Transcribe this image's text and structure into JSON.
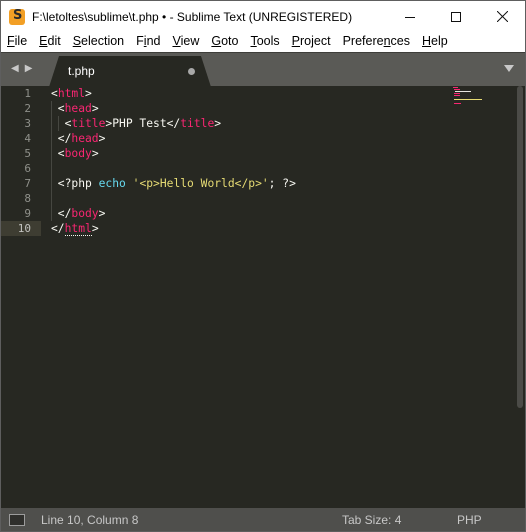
{
  "window": {
    "title": "F:\\letoltes\\sublime\\t.php • - Sublime Text (UNREGISTERED)",
    "app_icon": "sublime-text-icon"
  },
  "menu": [
    {
      "label": "File",
      "mnemonic": "F",
      "rest": "ile"
    },
    {
      "label": "Edit",
      "mnemonic": "E",
      "rest": "dit"
    },
    {
      "label": "Selection",
      "mnemonic": "S",
      "rest": "election"
    },
    {
      "label": "Find",
      "mnemonic": "i",
      "pre": "F",
      "rest": "nd"
    },
    {
      "label": "View",
      "mnemonic": "V",
      "rest": "iew"
    },
    {
      "label": "Goto",
      "mnemonic": "G",
      "rest": "oto"
    },
    {
      "label": "Tools",
      "mnemonic": "T",
      "rest": "ools"
    },
    {
      "label": "Project",
      "mnemonic": "P",
      "rest": "roject"
    },
    {
      "label": "Preferences",
      "mnemonic": "n",
      "pre": "Prefere",
      "rest": "ces"
    },
    {
      "label": "Help",
      "mnemonic": "H",
      "rest": "elp"
    }
  ],
  "tabs": [
    {
      "label": "t.php",
      "modified": true,
      "active": true
    }
  ],
  "editor": {
    "line_numbers": [
      "1",
      "2",
      "3",
      "4",
      "5",
      "6",
      "7",
      "8",
      "9",
      "10"
    ],
    "current_line": 10,
    "lines": [
      [
        {
          "t": "punc",
          "v": "<"
        },
        {
          "t": "tag",
          "v": "html"
        },
        {
          "t": "punc",
          "v": ">"
        }
      ],
      [
        {
          "t": "punc",
          "v": " <"
        },
        {
          "t": "tag",
          "v": "head"
        },
        {
          "t": "punc",
          "v": ">"
        }
      ],
      [
        {
          "t": "punc",
          "v": "  <"
        },
        {
          "t": "tag",
          "v": "title"
        },
        {
          "t": "punc",
          "v": ">PHP Test</"
        },
        {
          "t": "tag",
          "v": "title"
        },
        {
          "t": "punc",
          "v": ">"
        }
      ],
      [
        {
          "t": "punc",
          "v": " </"
        },
        {
          "t": "tag",
          "v": "head"
        },
        {
          "t": "punc",
          "v": ">"
        }
      ],
      [
        {
          "t": "punc",
          "v": " <"
        },
        {
          "t": "tag",
          "v": "body"
        },
        {
          "t": "punc",
          "v": ">"
        }
      ],
      [],
      [
        {
          "t": "punc",
          "v": " <?php "
        },
        {
          "t": "kw",
          "v": "echo"
        },
        {
          "t": "punc",
          "v": " "
        },
        {
          "t": "str",
          "v": "'<p>Hello World</p>'"
        },
        {
          "t": "punc",
          "v": "; ?>"
        }
      ],
      [],
      [
        {
          "t": "punc",
          "v": " </"
        },
        {
          "t": "tag",
          "v": "body"
        },
        {
          "t": "punc",
          "v": ">"
        }
      ],
      [
        {
          "t": "punc",
          "v": "</"
        },
        {
          "t": "tag",
          "v": "html",
          "dotted": true
        },
        {
          "t": "punc",
          "v": ">"
        }
      ]
    ]
  },
  "statusbar": {
    "position": "Line 10, Column 8",
    "tab_size": "Tab Size: 4",
    "syntax": "PHP"
  },
  "colors": {
    "background": "#272822",
    "tag": "#f92672",
    "string": "#e6db74",
    "keyword": "#66d9ef",
    "text": "#f8f8f2"
  }
}
